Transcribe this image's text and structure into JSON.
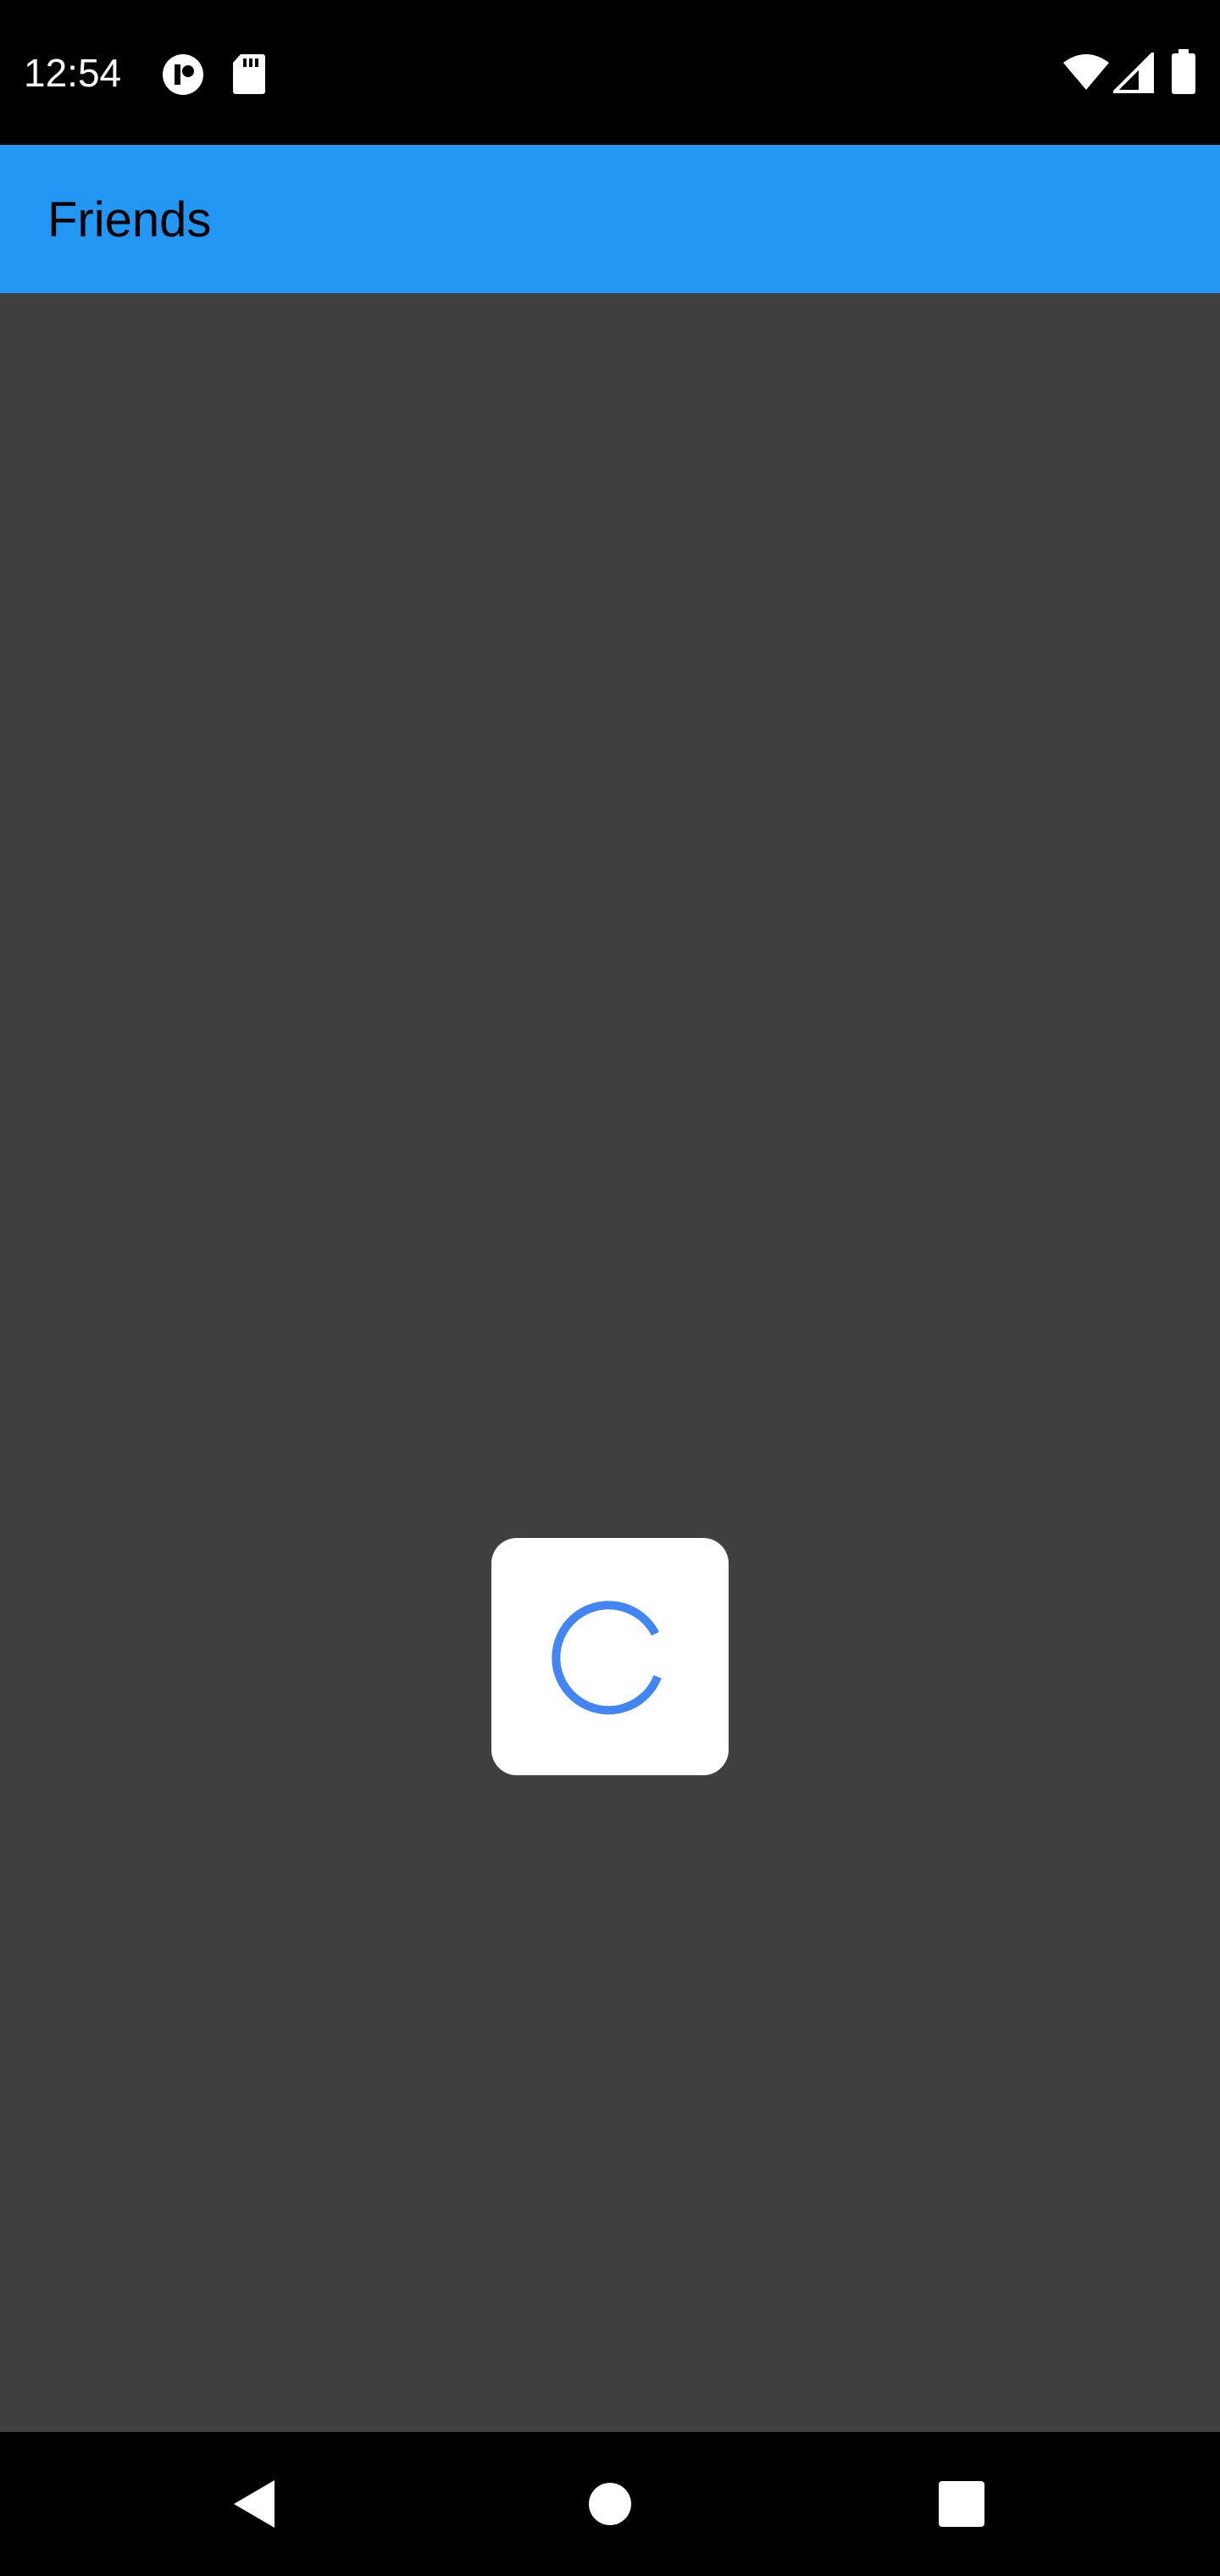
{
  "status_bar": {
    "time": "12:54",
    "left_icons": [
      "app-notification-icon",
      "sd-card-icon"
    ],
    "right_icons": [
      "wifi-icon",
      "cell-signal-icon",
      "battery-icon"
    ]
  },
  "app_bar": {
    "title": "Friends",
    "color": "#2196f3"
  },
  "content": {
    "background": "#404040",
    "loading_indicator": {
      "icon": "loading-spinner-icon",
      "color": "#4285f4"
    }
  },
  "nav_bar": {
    "buttons": [
      "back-icon",
      "home-icon",
      "recents-icon"
    ]
  }
}
